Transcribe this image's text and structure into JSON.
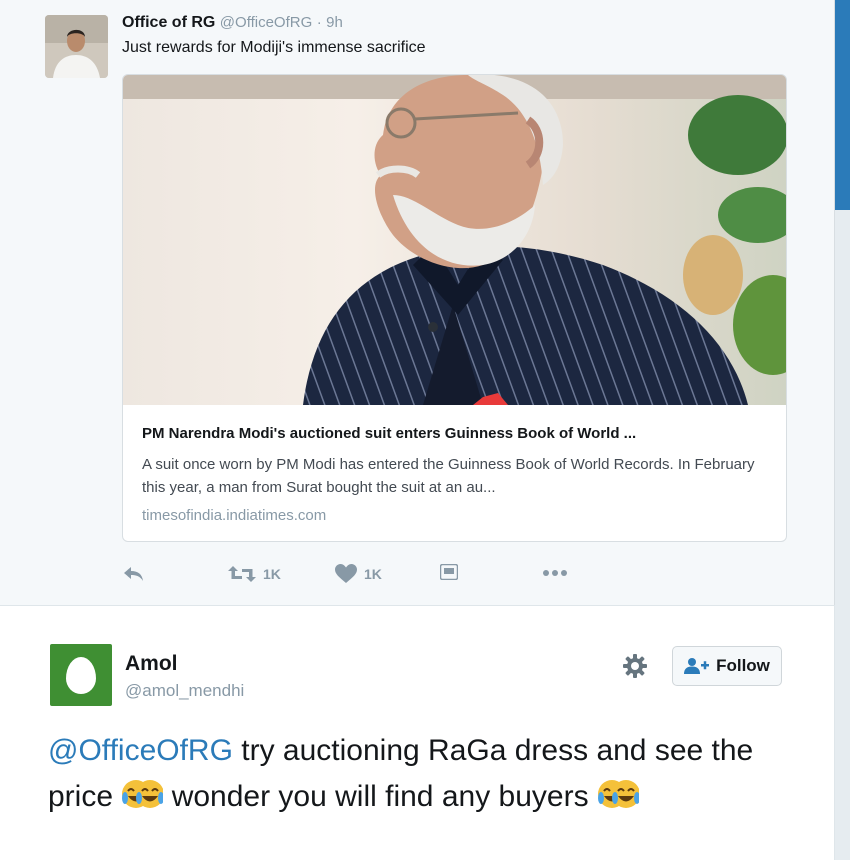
{
  "tweet1": {
    "author_name": "Office of RG",
    "author_handle": "@OfficeOfRG",
    "separator": "·",
    "time": "9h",
    "text": "Just rewards for Modiji's immense sacrifice",
    "card": {
      "title": "PM Narendra Modi's auctioned suit enters Guinness Book of World ...",
      "description": "A suit once worn by PM Modi has entered the Guinness Book of World Records. In February this year, a man from Surat bought the suit at an au...",
      "domain": "timesofindia.indiatimes.com"
    },
    "actions": {
      "retweet_count": "1K",
      "like_count": "1K"
    }
  },
  "tweet2": {
    "author_name": "Amol",
    "author_handle": "@amol_mendhi",
    "follow_label": "Follow",
    "mention": "@OfficeOfRG",
    "text_part1": " try auctioning RaGa dress and see the price ",
    "text_part2": " wonder you will find any buyers "
  },
  "colors": {
    "accent": "#2b7bb9",
    "secondary_text": "#8899a6",
    "avatar_green": "#3f8f33"
  },
  "icons": [
    "reply-icon",
    "retweet-icon",
    "heart-icon",
    "media-icon",
    "more-icon",
    "gear-icon",
    "follow-user-icon",
    "tears-of-joy-emoji"
  ]
}
